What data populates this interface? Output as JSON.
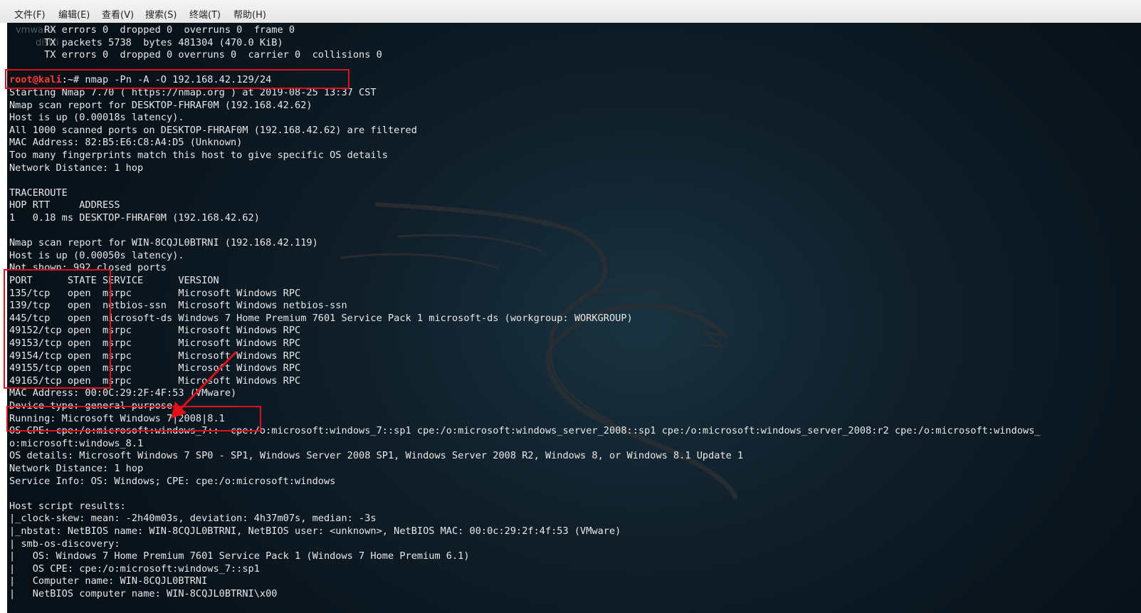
{
  "menu": {
    "file": "文件(F)",
    "edit": "编辑(E)",
    "view": "查看(V)",
    "search": "搜索(S)",
    "terminal": "终端(T)",
    "help": "帮助(H)"
  },
  "desktop": {
    "ghost1": "vmware-",
    "ghost2": "distri"
  },
  "prompt": {
    "user": "root@kali",
    "path": ":~",
    "command": "# nmap -Pn -A -O 192.168.42.129/24"
  },
  "output": [
    "      RX errors 0  dropped 0  overruns 0  frame 0",
    "      TX packets 5738  bytes 481304 (470.0 KiB)",
    "      TX errors 0  dropped 0 overruns 0  carrier 0  collisions 0",
    "",
    "__PROMPT__",
    "Starting Nmap 7.70 ( https://nmap.org ) at 2019-08-25 13:37 CST",
    "Nmap scan report for DESKTOP-FHRAF0M (192.168.42.62)",
    "Host is up (0.00018s latency).",
    "All 1000 scanned ports on DESKTOP-FHRAF0M (192.168.42.62) are filtered",
    "MAC Address: 82:B5:E6:C8:A4:D5 (Unknown)",
    "Too many fingerprints match this host to give specific OS details",
    "Network Distance: 1 hop",
    "",
    "TRACEROUTE",
    "HOP RTT     ADDRESS",
    "1   0.18 ms DESKTOP-FHRAF0M (192.168.42.62)",
    "",
    "Nmap scan report for WIN-8CQJL0BTRNI (192.168.42.119)",
    "Host is up (0.00050s latency).",
    "Not shown: 992 closed ports",
    "PORT      STATE SERVICE      VERSION",
    "135/tcp   open  msrpc        Microsoft Windows RPC",
    "139/tcp   open  netbios-ssn  Microsoft Windows netbios-ssn",
    "445/tcp   open  microsoft-ds Windows 7 Home Premium 7601 Service Pack 1 microsoft-ds (workgroup: WORKGROUP)",
    "49152/tcp open  msrpc        Microsoft Windows RPC",
    "49153/tcp open  msrpc        Microsoft Windows RPC",
    "49154/tcp open  msrpc        Microsoft Windows RPC",
    "49155/tcp open  msrpc        Microsoft Windows RPC",
    "49165/tcp open  msrpc        Microsoft Windows RPC",
    "MAC Address: 00:0C:29:2F:4F:53 (VMware)",
    "Device type: general purpose",
    "Running: Microsoft Windows 7|2008|8.1",
    "OS CPE: cpe:/o:microsoft:windows_7::- cpe:/o:microsoft:windows_7::sp1 cpe:/o:microsoft:windows_server_2008::sp1 cpe:/o:microsoft:windows_server_2008:r2 cpe:/o:microsoft:windows_",
    "o:microsoft:windows_8.1",
    "OS details: Microsoft Windows 7 SP0 - SP1, Windows Server 2008 SP1, Windows Server 2008 R2, Windows 8, or Windows 8.1 Update 1",
    "Network Distance: 1 hop",
    "Service Info: OS: Windows; CPE: cpe:/o:microsoft:windows",
    "",
    "Host script results:",
    "|_clock-skew: mean: -2h40m03s, deviation: 4h37m07s, median: -3s",
    "|_nbstat: NetBIOS name: WIN-8CQJL0BTRNI, NetBIOS user: <unknown>, NetBIOS MAC: 00:0c:29:2f:4f:53 (VMware)",
    "| smb-os-discovery:",
    "|   OS: Windows 7 Home Premium 7601 Service Pack 1 (Windows 7 Home Premium 6.1)",
    "|   OS CPE: cpe:/o:microsoft:windows_7::sp1",
    "|   Computer name: WIN-8CQJL0BTRNI",
    "|   NetBIOS computer name: WIN-8CQJL0BTRNI\\x00"
  ],
  "colors": {
    "annotation": "#e0101a",
    "prompt_user": "#ff3b30",
    "text": "#e8e8e8"
  },
  "annotations": [
    "command-box",
    "port-state-box",
    "running-os-box",
    "arrow"
  ]
}
